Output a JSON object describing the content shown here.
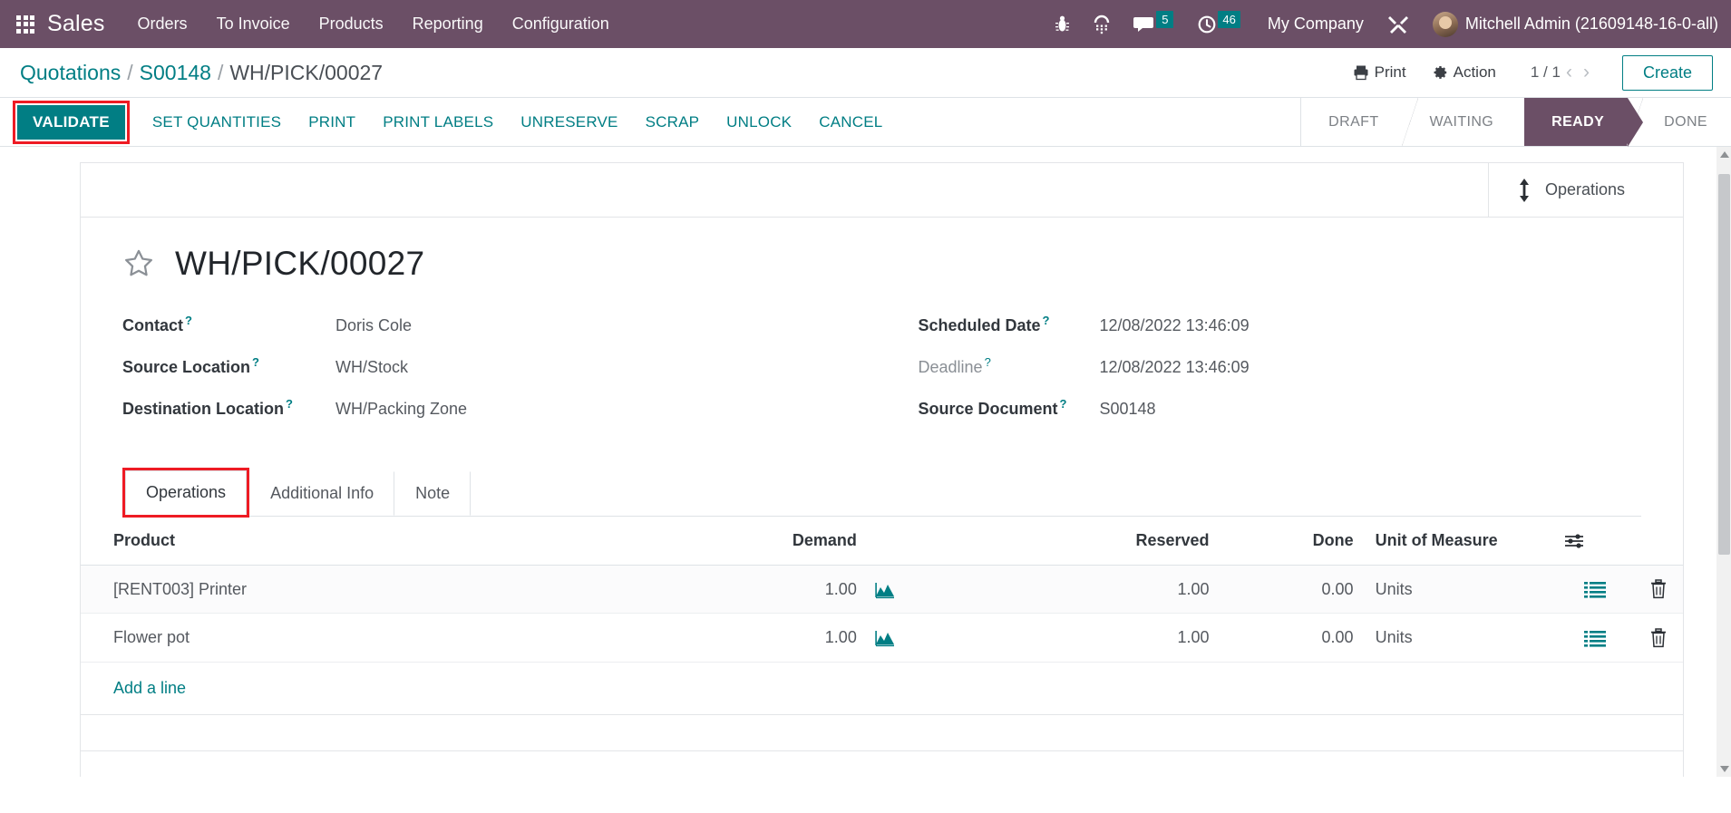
{
  "navbar": {
    "apps_icon": "apps-grid-icon",
    "brand": "Sales",
    "menu": [
      {
        "label": "Orders"
      },
      {
        "label": "To Invoice"
      },
      {
        "label": "Products"
      },
      {
        "label": "Reporting"
      },
      {
        "label": "Configuration"
      }
    ],
    "icons": [
      {
        "name": "bug-icon",
        "glyph": "⚘"
      },
      {
        "name": "phone-keypad-icon",
        "glyph": "☎"
      }
    ],
    "messages": {
      "icon": "chat-bubble-icon",
      "count": "5"
    },
    "activities": {
      "icon": "clock-icon",
      "count": "46"
    },
    "company": "My Company",
    "tools_icon": "wrench-screwdriver-icon",
    "user": "Mitchell Admin (21609148-16-0-all)"
  },
  "control_panel": {
    "breadcrumb": [
      {
        "label": "Quotations",
        "link": true
      },
      {
        "label": "S00148",
        "link": true
      },
      {
        "label": "WH/PICK/00027",
        "link": false
      }
    ],
    "separator": "/",
    "print_label": "Print",
    "print_icon": "printer-icon",
    "action_label": "Action",
    "action_icon": "gear-icon",
    "pager": "1 / 1",
    "prev_icon": "chevron-left-icon",
    "next_icon": "chevron-right-icon",
    "create_label": "Create"
  },
  "action_bar": {
    "buttons": [
      {
        "label": "VALIDATE",
        "primary": true,
        "highlighted": true
      },
      {
        "label": "SET QUANTITIES",
        "primary": false,
        "highlighted": false
      },
      {
        "label": "PRINT",
        "primary": false,
        "highlighted": false
      },
      {
        "label": "PRINT LABELS",
        "primary": false,
        "highlighted": false
      },
      {
        "label": "UNRESERVE",
        "primary": false,
        "highlighted": false
      },
      {
        "label": "SCRAP",
        "primary": false,
        "highlighted": false
      },
      {
        "label": "UNLOCK",
        "primary": false,
        "highlighted": false
      },
      {
        "label": "CANCEL",
        "primary": false,
        "highlighted": false
      }
    ],
    "statuses": [
      {
        "label": "DRAFT",
        "active": false
      },
      {
        "label": "WAITING",
        "active": false
      },
      {
        "label": "READY",
        "active": true
      },
      {
        "label": "DONE",
        "active": false
      }
    ]
  },
  "sheet": {
    "smart_button": {
      "label": "Operations",
      "icon": "up-down-arrow-icon"
    },
    "favorite_icon": "star-outline-icon",
    "title": "WH/PICK/00027",
    "fields_left": [
      {
        "label": "Contact",
        "value": "Doris Cole",
        "help": "?",
        "muted": false
      },
      {
        "label": "Source Location",
        "value": "WH/Stock",
        "help": "?",
        "muted": false
      },
      {
        "label": "Destination Location",
        "value": "WH/Packing Zone",
        "help": "?",
        "muted": false
      }
    ],
    "fields_right": [
      {
        "label": "Scheduled Date",
        "value": "12/08/2022 13:46:09",
        "help": "?",
        "muted": false
      },
      {
        "label": "Deadline",
        "value": "12/08/2022 13:46:09",
        "help": "?",
        "muted": true
      },
      {
        "label": "Source Document",
        "value": "S00148",
        "help": "?",
        "muted": false
      }
    ],
    "tabs": [
      {
        "label": "Operations",
        "active": true,
        "highlighted": true
      },
      {
        "label": "Additional Info",
        "active": false,
        "highlighted": false
      },
      {
        "label": "Note",
        "active": false,
        "highlighted": false
      }
    ],
    "table": {
      "columns": [
        "Product",
        "Demand",
        "Reserved",
        "Done",
        "Unit of Measure"
      ],
      "options_icon": "column-options-icon",
      "rows": [
        {
          "product": "[RENT003] Printer",
          "demand": "1.00",
          "forecast_icon": "area-chart-icon",
          "reserved": "1.00",
          "done": "0.00",
          "uom": "Units",
          "detail_icon": "list-lines-icon",
          "delete_icon": "trash-icon"
        },
        {
          "product": "Flower pot",
          "demand": "1.00",
          "forecast_icon": "area-chart-icon",
          "reserved": "1.00",
          "done": "0.00",
          "uom": "Units",
          "detail_icon": "list-lines-icon",
          "delete_icon": "trash-icon"
        }
      ],
      "add_line_label": "Add a line"
    }
  },
  "colors": {
    "brand_purple": "#6b4f66",
    "accent_teal": "#017e84",
    "highlight_red": "#ee1b24"
  }
}
